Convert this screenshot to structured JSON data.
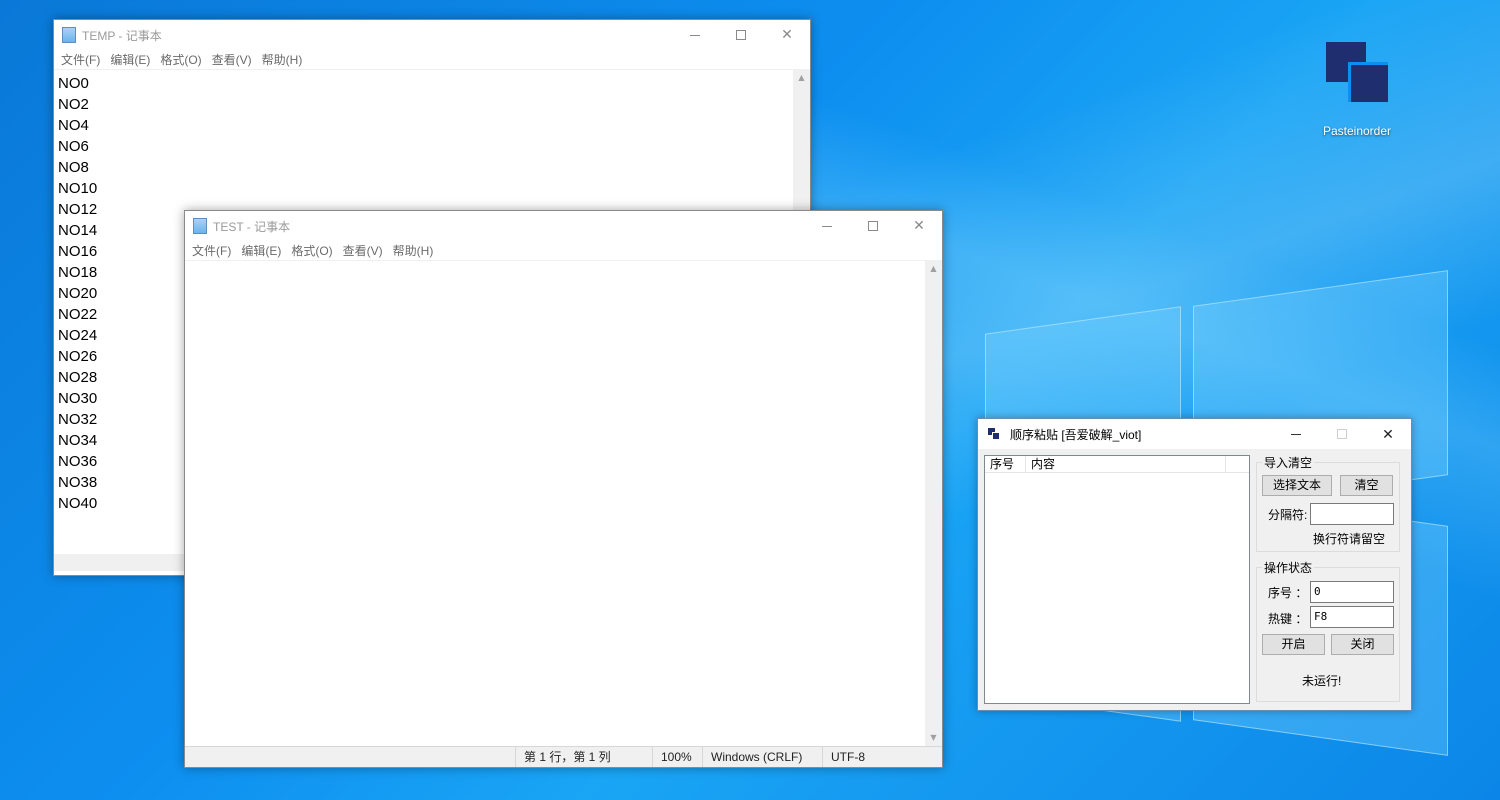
{
  "desktop": {
    "icon_label": "Pasteinorder"
  },
  "temp_window": {
    "title": "TEMP - 记事本",
    "menu": [
      "文件(F)",
      "编辑(E)",
      "格式(O)",
      "查看(V)",
      "帮助(H)"
    ],
    "lines": [
      "NO0",
      "NO2",
      "NO4",
      "NO6",
      "NO8",
      "NO10",
      "NO12",
      "NO14",
      "NO16",
      "NO18",
      "NO20",
      "NO22",
      "NO24",
      "NO26",
      "NO28",
      "NO30",
      "NO32",
      "NO34",
      "NO36",
      "NO38",
      "NO40"
    ]
  },
  "test_window": {
    "title": "TEST - 记事本",
    "menu": [
      "文件(F)",
      "编辑(E)",
      "格式(O)",
      "查看(V)",
      "帮助(H)"
    ],
    "status": {
      "position": "第 1 行，第 1 列",
      "zoom": "100%",
      "line_ending": "Windows (CRLF)",
      "encoding": "UTF-8"
    }
  },
  "paste_app": {
    "title": "顺序粘贴 [吾爱破解_viot]",
    "list_headers": [
      "序号",
      "内容"
    ],
    "import_group": {
      "title": "导入清空",
      "select_button": "选择文本",
      "clear_button": "清空",
      "separator_label": "分隔符:",
      "separator_value": "",
      "hint": "换行符请留空"
    },
    "status_group": {
      "title": "操作状态",
      "index_label": "序号 ：",
      "index_value": "0",
      "hotkey_label": "热键 ：",
      "hotkey_value": "F8",
      "start_button": "开启",
      "stop_button": "关闭",
      "state_text": "未运行!"
    }
  }
}
